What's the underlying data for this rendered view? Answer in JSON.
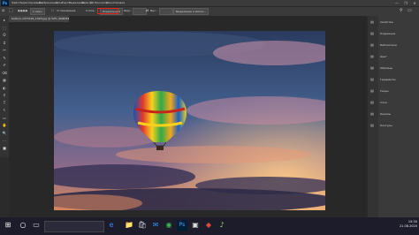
{
  "app": {
    "logo": "Ps",
    "menu": [
      "Файл",
      "Редактирование",
      "Изображение",
      "Слои",
      "Текст",
      "Выделение",
      "Фильтр",
      "3D",
      "Просмотр",
      "Окно",
      "Справка"
    ],
    "window_controls": [
      "—",
      "❐",
      "✕"
    ]
  },
  "options_bar": {
    "size_value": "1 пикс.",
    "antialias_label": "Сглаживание",
    "style_label": "Стиль:",
    "style_value": "Нормальный",
    "width_label": "Шир.:",
    "height_label": "Выс.:",
    "select_mask_button": "Выделение и маска..."
  },
  "document": {
    "tab_title": "balloon-1373199_1920.jpg @ 50% (RGB/8#)"
  },
  "tools": [
    "▸",
    "⬚",
    "ʘ",
    "⌗",
    "✂",
    "✎",
    "✐",
    "⌫",
    "▦",
    "◐",
    "⚲",
    "T",
    "↖",
    "▭",
    "✋",
    "🔍",
    "…",
    "■"
  ],
  "panels": [
    {
      "label": "Свойства",
      "icon": "properties-icon"
    },
    {
      "label": "Коррекция",
      "icon": "adjustments-icon"
    },
    {
      "label": "Библиотеки",
      "icon": "libraries-icon"
    },
    {
      "label": "Цвет",
      "icon": "color-icon"
    },
    {
      "label": "Образцы",
      "icon": "swatches-icon"
    },
    {
      "label": "Градиенты",
      "icon": "gradients-icon"
    },
    {
      "label": "Узоры",
      "icon": "patterns-icon"
    },
    {
      "label": "Слои",
      "icon": "layers-icon"
    },
    {
      "label": "Каналы",
      "icon": "channels-icon"
    },
    {
      "label": "Контуры",
      "icon": "paths-icon"
    }
  ],
  "taskbar": {
    "apps": [
      "⊞",
      "○",
      "▭",
      "e",
      "📁",
      "🛍",
      "✉",
      "◉",
      "Ps",
      "▣",
      "◆",
      "♪"
    ],
    "time": "15:30",
    "date": "21.08.2020"
  },
  "colors": {
    "highlight": "#e0241b",
    "ps_brand": "#31a8ff"
  }
}
